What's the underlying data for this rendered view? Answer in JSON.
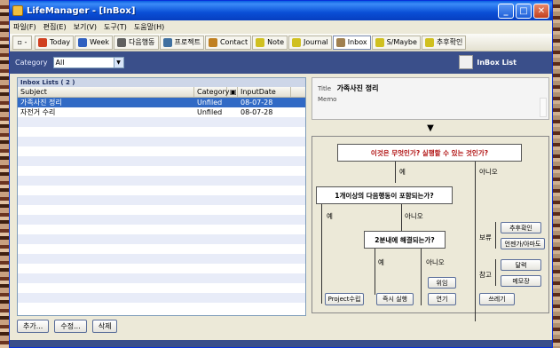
{
  "window": {
    "title": "LifeManager - [InBox]",
    "controls": {
      "minimize": "_",
      "maximize": "□",
      "close": "✕"
    }
  },
  "menu": [
    "파일(F)",
    "편집(E)",
    "보기(V)",
    "도구(T)",
    "도움말(H)"
  ],
  "toolbar": {
    "first": "▫ -",
    "items": [
      {
        "label": "Today",
        "icon": "today-icon",
        "color": "#d04020"
      },
      {
        "label": "Week",
        "icon": "week-icon",
        "color": "#3060c0"
      },
      {
        "label": "다음행동",
        "icon": "next-action-icon",
        "color": "#606060"
      },
      {
        "label": "프로젝트",
        "icon": "project-icon",
        "color": "#4070a0"
      },
      {
        "label": "Contact",
        "icon": "contact-icon",
        "color": "#c08020"
      },
      {
        "label": "Note",
        "icon": "note-icon",
        "color": "#d0c020"
      },
      {
        "label": "Journal",
        "icon": "journal-icon",
        "color": "#d0c020"
      },
      {
        "label": "Inbox",
        "icon": "inbox-icon",
        "color": "#a08050",
        "active": true
      },
      {
        "label": "S/Maybe",
        "icon": "someday-icon",
        "color": "#d0c020"
      },
      {
        "label": "추후확인",
        "icon": "followup-icon",
        "color": "#d0c020"
      }
    ]
  },
  "category_bar": {
    "label": "Category",
    "value": "All",
    "right_title": "InBox List"
  },
  "inbox": {
    "title": "Inbox Lists ( 2 )",
    "columns": {
      "subject": "Subject",
      "category": "Category",
      "flag": "▣",
      "date": "InputDate"
    },
    "rows": [
      {
        "subject": "가족사진 정리",
        "category": "Unfiled",
        "date": "08-07-28",
        "selected": true
      },
      {
        "subject": "자전거 수리",
        "category": "Unfiled",
        "date": "08-07-28",
        "selected": false
      }
    ]
  },
  "buttons": {
    "add": "추가...",
    "edit": "수정...",
    "delete": "삭제"
  },
  "detail": {
    "title_label": "Title",
    "title_value": "가족사진 정리",
    "memo_label": "Memo",
    "arrow": "▼"
  },
  "flow": {
    "q1": "이것은 무엇인가? 실행할 수 있는 것인가?",
    "yes": "예",
    "no": "아니오",
    "q2": "1개이상의 다음행동이 포함되는가?",
    "q3": "2분내에 해결되는가?",
    "hold": "보류",
    "reference": "참고",
    "btn_project": "Project수립",
    "btn_do_now": "즉시 실행",
    "btn_delegate": "위임",
    "btn_defer": "연기",
    "btn_trash": "쓰레기",
    "btn_followup": "추후확인",
    "btn_someday": "언젠가/아마도",
    "btn_calendar": "달력",
    "btn_memo": "메모장"
  }
}
